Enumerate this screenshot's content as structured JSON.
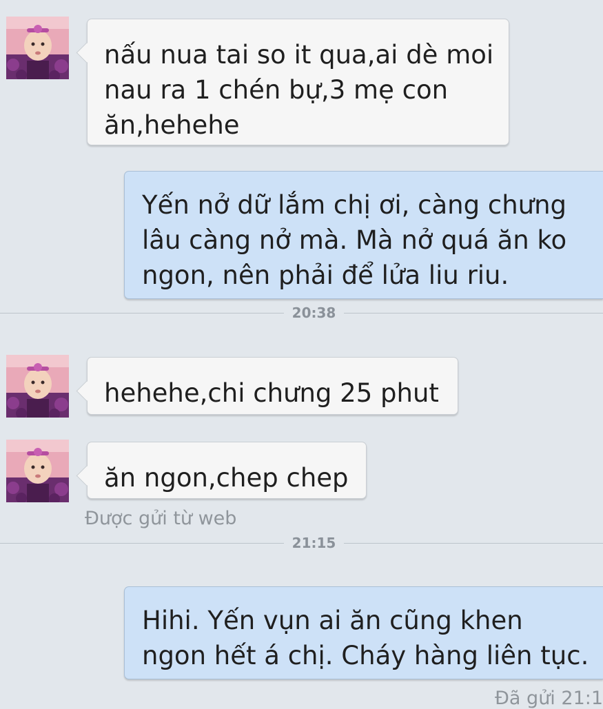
{
  "messages": [
    {
      "from": "contact",
      "lines": [
        "nấu nua tai so it qua,ai dè moi",
        "nau ra 1 chén bự,3 mẹ con",
        "ăn,hehehe"
      ]
    },
    {
      "from": "me",
      "lines": [
        "Yến nở dữ lắm chị ơi, càng chưng",
        "lâu càng nở mà. Mà nở quá ăn ko",
        "ngon, nên phải để lửa liu riu."
      ]
    },
    {
      "from": "contact",
      "lines": [
        "hehehe,chi chưng 25 phut"
      ]
    },
    {
      "from": "contact",
      "lines": [
        "ăn ngon,chep chep"
      ]
    },
    {
      "from": "me",
      "lines": [
        "Hihi. Yến vụn ai ăn cũng khen",
        "ngon hết á chị. Cháy hàng liên tục."
      ]
    }
  ],
  "dividers": [
    "20:38",
    "21:15"
  ],
  "sent_from_web": "Được gửi từ web",
  "delivery_status": "Đã gửi 21:1",
  "colors": {
    "background": "#e2e7ec",
    "incoming_bubble": "#f6f6f6",
    "outgoing_bubble": "#cde1f7"
  },
  "icons": {
    "avatar": "baby-girl-avatar-photo"
  }
}
